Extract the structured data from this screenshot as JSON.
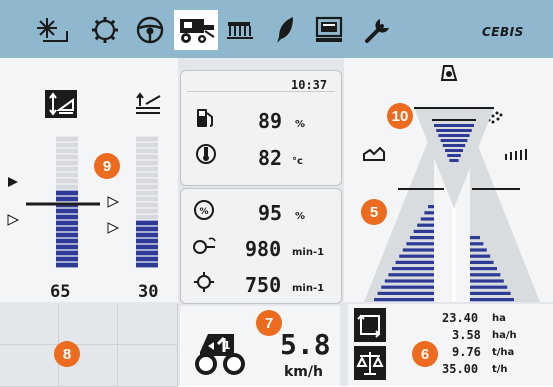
{
  "topbar": {
    "icons": [
      "sun-icon",
      "gear-icon",
      "steering-wheel-icon",
      "combine-harvester-icon",
      "header-reel-icon",
      "feather-icon",
      "computer-monitor-icon",
      "wrench-icon"
    ],
    "brand": "CEBIS"
  },
  "left": {
    "value_left": "65",
    "value_right": "30"
  },
  "center": {
    "time": "10:37",
    "fuel_value": "89",
    "fuel_unit": "%",
    "temp_value": "82",
    "temp_unit": "°c",
    "load_value": "95",
    "load_unit": "%",
    "engine_value": "980",
    "engine_unit": "min-1",
    "drum_value": "750",
    "drum_unit": "min-1",
    "gear": "1",
    "speed_value": "5.8",
    "speed_unit": "km/h"
  },
  "right": {
    "ha_value": "23.40",
    "ha_unit": "ha",
    "hah_value": "3.58",
    "hah_unit": "ha/h",
    "tha_value": "9.76",
    "tha_unit": "t/ha",
    "th_value": "35.00",
    "th_unit": "t/h"
  },
  "badges": [
    "10",
    "9",
    "5",
    "7",
    "8",
    "6"
  ],
  "colors": {
    "topbar": "#8fb8cf",
    "bar_fill": "#2d3b97",
    "badge": "#ec6b1e"
  }
}
